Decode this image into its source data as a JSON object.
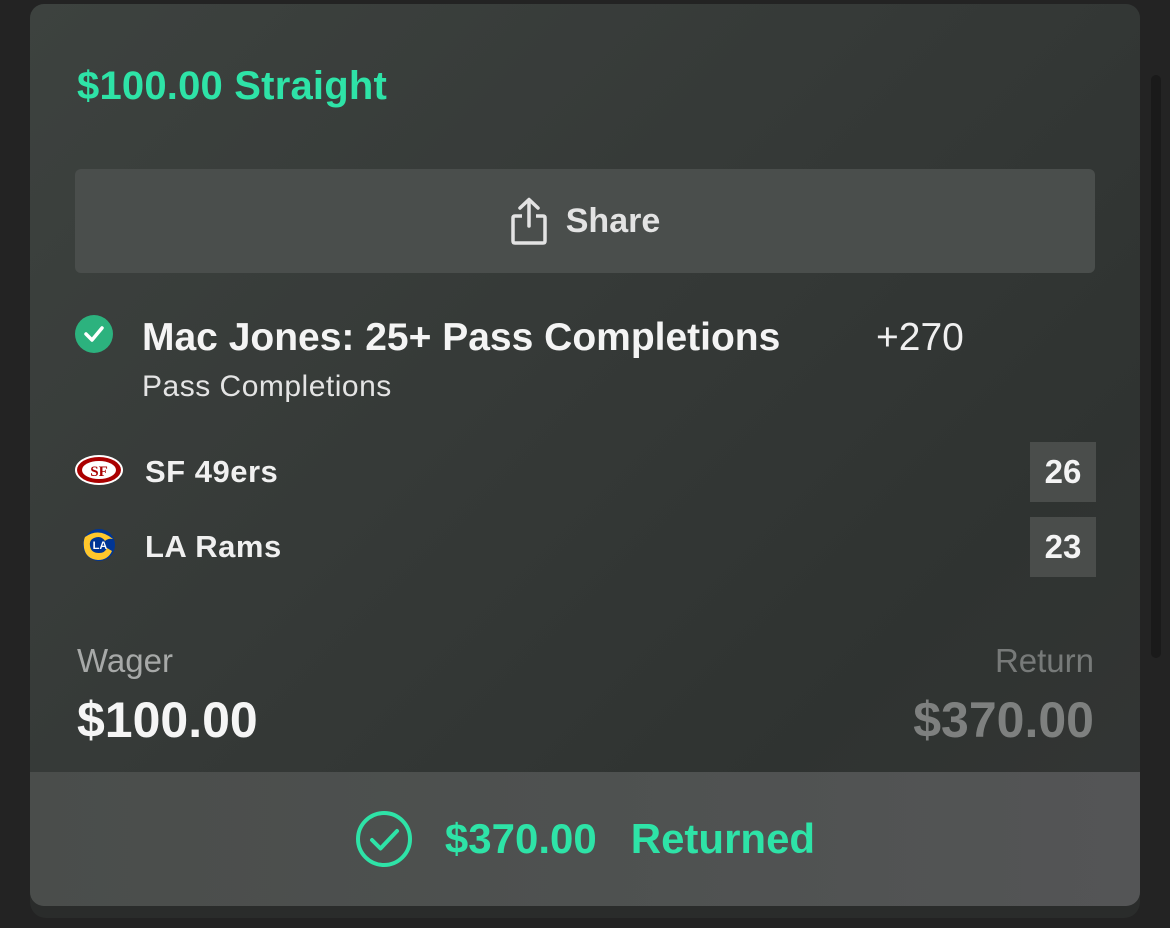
{
  "bet": {
    "title": "$100.00 Straight"
  },
  "share": {
    "label": "Share",
    "icon": "share-icon"
  },
  "selection": {
    "name": "Mac Jones: 25+ Pass Completions",
    "odds": "+270",
    "market": "Pass Completions",
    "status_icon": "check-circle-icon"
  },
  "teams": [
    {
      "name": "SF 49ers",
      "score": "26",
      "logo": "49ers-logo",
      "logo_text": "SF",
      "color": "#aa0000"
    },
    {
      "name": "LA Rams",
      "score": "23",
      "logo": "rams-logo",
      "logo_text": "LA",
      "color": "#003594"
    }
  ],
  "wager": {
    "label": "Wager",
    "value": "$100.00"
  },
  "return": {
    "label": "Return",
    "value": "$370.00"
  },
  "result": {
    "amount": "$370.00",
    "status": "Returned",
    "icon": "check-circle-outline-icon"
  },
  "colors": {
    "accent": "#2ee3a7",
    "success_badge": "#2cb27e",
    "card_background": "#383c3a",
    "button_background": "#4a4e4c"
  }
}
